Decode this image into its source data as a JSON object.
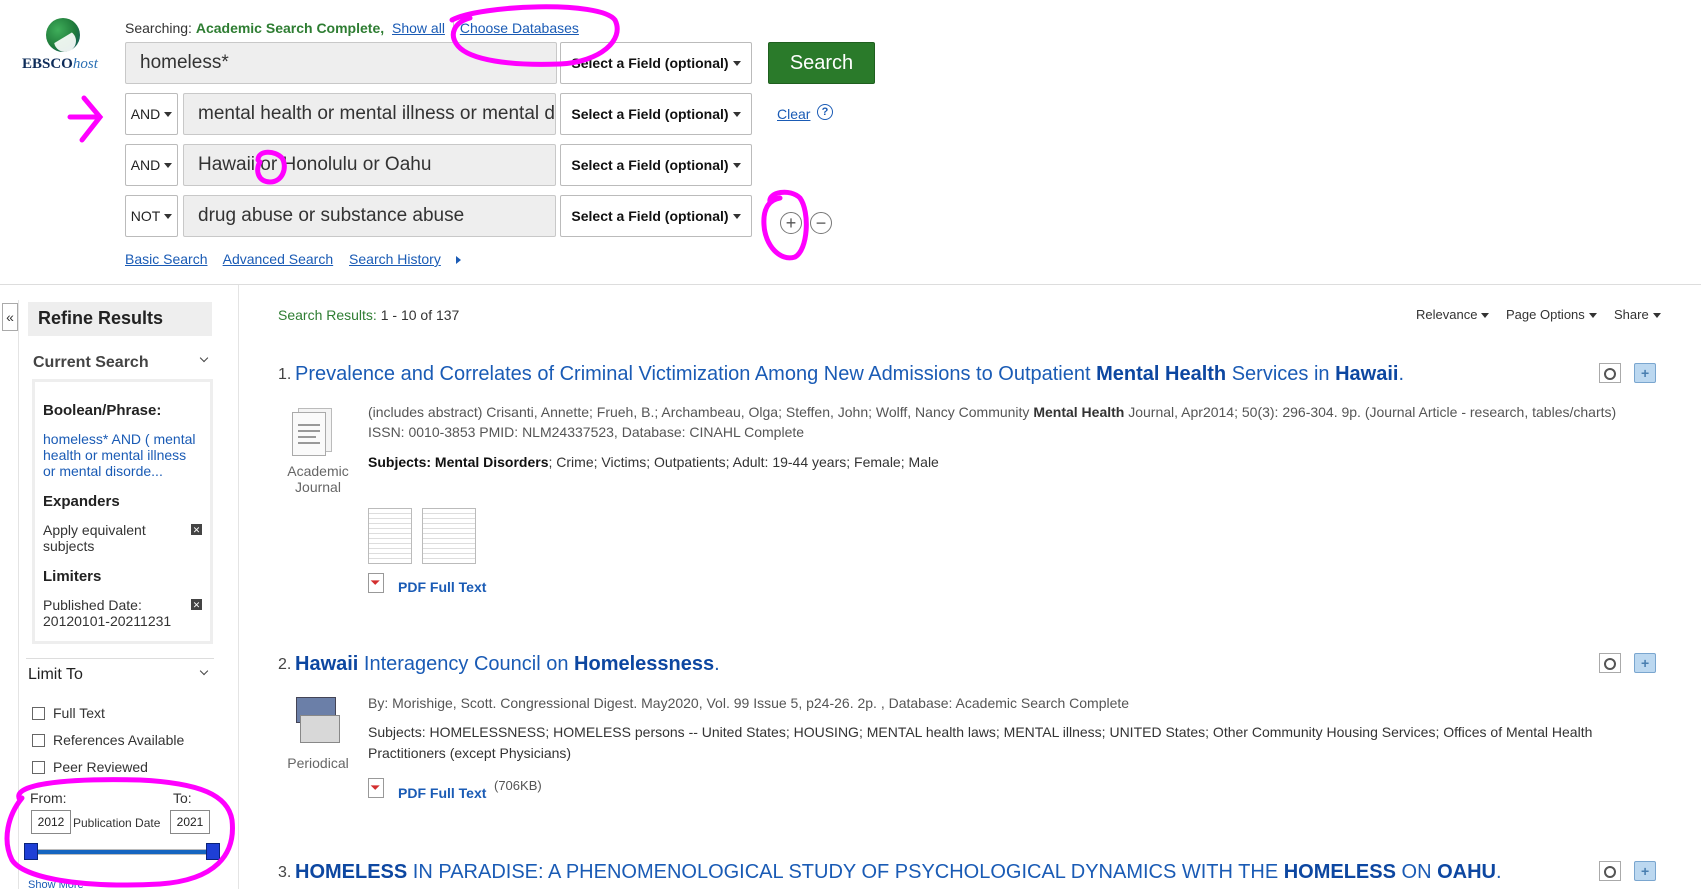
{
  "app": {
    "logo_main": "EBSCO",
    "logo_sub": "host"
  },
  "header": {
    "searching_label": "Searching:",
    "database": "Academic Search Complete,",
    "show_all": "Show all",
    "choose_databases": "Choose Databases",
    "search_button": "Search",
    "clear": "Clear",
    "help": "?"
  },
  "query_rows": [
    {
      "operator": "",
      "term": "homeless*",
      "field": "Select a Field (optional)"
    },
    {
      "operator": "AND",
      "term": "mental health or mental illness or mental disorder",
      "field": "Select a Field (optional)"
    },
    {
      "operator": "AND",
      "term": "Hawaii or Honolulu or Oahu",
      "field": "Select a Field (optional)"
    },
    {
      "operator": "NOT",
      "term": "drug abuse or substance abuse",
      "field": "Select a Field (optional)"
    }
  ],
  "tools": {
    "basic": "Basic Search",
    "advanced": "Advanced Search",
    "history": "Search History"
  },
  "sidebar": {
    "collapse": "«",
    "refine_title": "Refine Results",
    "current_search": "Current Search",
    "boolean_heading": "Boolean/Phrase:",
    "boolean_value": "homeless* AND ( mental health or mental illness or mental disorde...",
    "expanders_heading": "Expanders",
    "expander_item": "Apply equivalent subjects",
    "limiters_heading": "Limiters",
    "limiter_item": "Published Date: 20120101-20211231",
    "limit_to": "Limit To",
    "checkboxes": [
      "Full Text",
      "References Available",
      "Peer Reviewed"
    ],
    "from_label": "From:",
    "to_label": "To:",
    "from_year": "2012",
    "to_year": "2021",
    "pub_date_label": "Publication Date",
    "show_more": "Show More"
  },
  "results_header": {
    "label": "Search Results:",
    "range": "1 - 10 of 137",
    "relevance": "Relevance",
    "page_options": "Page Options",
    "share": "Share"
  },
  "results": [
    {
      "num": "1.",
      "title_parts": [
        "Prevalence and Correlates of Criminal Victimization Among New Admissions to Outpatient ",
        "Mental Health",
        " Services in ",
        "Hawaii",
        "."
      ],
      "meta1_a": "(includes abstract) Crisanti, Annette; Frueh, B.; Archambeau, Olga; Steffen, John; Wolff, Nancy Community ",
      "meta1_b": "Mental Health",
      "meta1_c": " Journal, Apr2014; 50(3): 296-304. 9p. (Journal Article - research, tables/charts)",
      "meta2": "ISSN: 0010-3853 PMID: NLM24337523, Database: CINAHL Complete",
      "subjects_label": "Subjects:",
      "subjects_bold": "Mental Disorders",
      "subjects_rest": "; Crime; Victims; Outpatients; Adult: 19-44 years; Female; Male",
      "type_line1": "Academic",
      "type_line2": "Journal",
      "pdf": "PDF Full Text"
    },
    {
      "num": "2.",
      "title_parts": [
        "Hawaii",
        " Interagency Council on ",
        "Homelessness",
        "."
      ],
      "meta1": "By: Morishige, Scott. Congressional Digest. May2020, Vol. 99 Issue 5, p24-26. 2p. , Database: Academic Search Complete",
      "subjects_line": "Subjects: HOMELESSNESS; HOMELESS persons -- United States; HOUSING; MENTAL health laws; MENTAL illness; UNITED States; Other Community Housing Services; Offices of Mental Health",
      "subjects_line2": "Practitioners (except Physicians)",
      "type_line1": "Periodical",
      "pdf": "PDF Full Text",
      "pdf_size": "(706KB)"
    },
    {
      "num": "3.",
      "title_parts": [
        "HOMELESS",
        " IN PARADISE: A PHENOMENOLOGICAL STUDY OF PSYCHOLOGICAL DYNAMICS WITH THE ",
        "HOMELESS",
        " ON ",
        "OAHU",
        "."
      ]
    }
  ],
  "colors": {
    "link": "#1a5bb5",
    "search_button": "#2a7a2a",
    "annotation": "#ff00ff",
    "database_name": "#2e7d32"
  }
}
